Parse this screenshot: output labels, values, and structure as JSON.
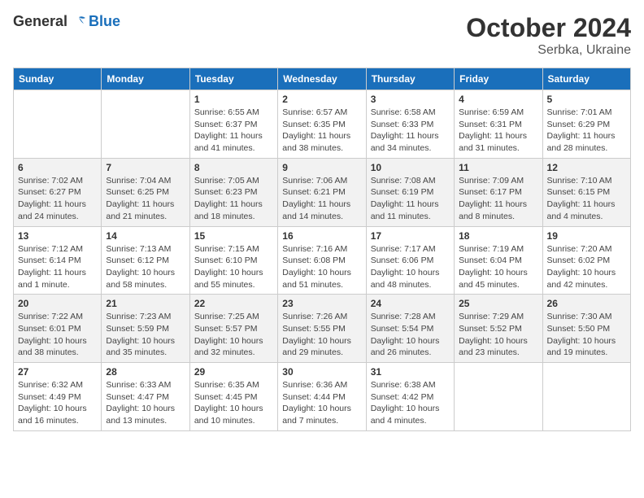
{
  "header": {
    "logo_general": "General",
    "logo_blue": "Blue",
    "month_title": "October 2024",
    "subtitle": "Serbka, Ukraine"
  },
  "weekdays": [
    "Sunday",
    "Monday",
    "Tuesday",
    "Wednesday",
    "Thursday",
    "Friday",
    "Saturday"
  ],
  "weeks": [
    [
      {
        "day": "",
        "info": ""
      },
      {
        "day": "",
        "info": ""
      },
      {
        "day": "1",
        "info": "Sunrise: 6:55 AM\nSunset: 6:37 PM\nDaylight: 11 hours and 41 minutes."
      },
      {
        "day": "2",
        "info": "Sunrise: 6:57 AM\nSunset: 6:35 PM\nDaylight: 11 hours and 38 minutes."
      },
      {
        "day": "3",
        "info": "Sunrise: 6:58 AM\nSunset: 6:33 PM\nDaylight: 11 hours and 34 minutes."
      },
      {
        "day": "4",
        "info": "Sunrise: 6:59 AM\nSunset: 6:31 PM\nDaylight: 11 hours and 31 minutes."
      },
      {
        "day": "5",
        "info": "Sunrise: 7:01 AM\nSunset: 6:29 PM\nDaylight: 11 hours and 28 minutes."
      }
    ],
    [
      {
        "day": "6",
        "info": "Sunrise: 7:02 AM\nSunset: 6:27 PM\nDaylight: 11 hours and 24 minutes."
      },
      {
        "day": "7",
        "info": "Sunrise: 7:04 AM\nSunset: 6:25 PM\nDaylight: 11 hours and 21 minutes."
      },
      {
        "day": "8",
        "info": "Sunrise: 7:05 AM\nSunset: 6:23 PM\nDaylight: 11 hours and 18 minutes."
      },
      {
        "day": "9",
        "info": "Sunrise: 7:06 AM\nSunset: 6:21 PM\nDaylight: 11 hours and 14 minutes."
      },
      {
        "day": "10",
        "info": "Sunrise: 7:08 AM\nSunset: 6:19 PM\nDaylight: 11 hours and 11 minutes."
      },
      {
        "day": "11",
        "info": "Sunrise: 7:09 AM\nSunset: 6:17 PM\nDaylight: 11 hours and 8 minutes."
      },
      {
        "day": "12",
        "info": "Sunrise: 7:10 AM\nSunset: 6:15 PM\nDaylight: 11 hours and 4 minutes."
      }
    ],
    [
      {
        "day": "13",
        "info": "Sunrise: 7:12 AM\nSunset: 6:14 PM\nDaylight: 11 hours and 1 minute."
      },
      {
        "day": "14",
        "info": "Sunrise: 7:13 AM\nSunset: 6:12 PM\nDaylight: 10 hours and 58 minutes."
      },
      {
        "day": "15",
        "info": "Sunrise: 7:15 AM\nSunset: 6:10 PM\nDaylight: 10 hours and 55 minutes."
      },
      {
        "day": "16",
        "info": "Sunrise: 7:16 AM\nSunset: 6:08 PM\nDaylight: 10 hours and 51 minutes."
      },
      {
        "day": "17",
        "info": "Sunrise: 7:17 AM\nSunset: 6:06 PM\nDaylight: 10 hours and 48 minutes."
      },
      {
        "day": "18",
        "info": "Sunrise: 7:19 AM\nSunset: 6:04 PM\nDaylight: 10 hours and 45 minutes."
      },
      {
        "day": "19",
        "info": "Sunrise: 7:20 AM\nSunset: 6:02 PM\nDaylight: 10 hours and 42 minutes."
      }
    ],
    [
      {
        "day": "20",
        "info": "Sunrise: 7:22 AM\nSunset: 6:01 PM\nDaylight: 10 hours and 38 minutes."
      },
      {
        "day": "21",
        "info": "Sunrise: 7:23 AM\nSunset: 5:59 PM\nDaylight: 10 hours and 35 minutes."
      },
      {
        "day": "22",
        "info": "Sunrise: 7:25 AM\nSunset: 5:57 PM\nDaylight: 10 hours and 32 minutes."
      },
      {
        "day": "23",
        "info": "Sunrise: 7:26 AM\nSunset: 5:55 PM\nDaylight: 10 hours and 29 minutes."
      },
      {
        "day": "24",
        "info": "Sunrise: 7:28 AM\nSunset: 5:54 PM\nDaylight: 10 hours and 26 minutes."
      },
      {
        "day": "25",
        "info": "Sunrise: 7:29 AM\nSunset: 5:52 PM\nDaylight: 10 hours and 23 minutes."
      },
      {
        "day": "26",
        "info": "Sunrise: 7:30 AM\nSunset: 5:50 PM\nDaylight: 10 hours and 19 minutes."
      }
    ],
    [
      {
        "day": "27",
        "info": "Sunrise: 6:32 AM\nSunset: 4:49 PM\nDaylight: 10 hours and 16 minutes."
      },
      {
        "day": "28",
        "info": "Sunrise: 6:33 AM\nSunset: 4:47 PM\nDaylight: 10 hours and 13 minutes."
      },
      {
        "day": "29",
        "info": "Sunrise: 6:35 AM\nSunset: 4:45 PM\nDaylight: 10 hours and 10 minutes."
      },
      {
        "day": "30",
        "info": "Sunrise: 6:36 AM\nSunset: 4:44 PM\nDaylight: 10 hours and 7 minutes."
      },
      {
        "day": "31",
        "info": "Sunrise: 6:38 AM\nSunset: 4:42 PM\nDaylight: 10 hours and 4 minutes."
      },
      {
        "day": "",
        "info": ""
      },
      {
        "day": "",
        "info": ""
      }
    ]
  ]
}
